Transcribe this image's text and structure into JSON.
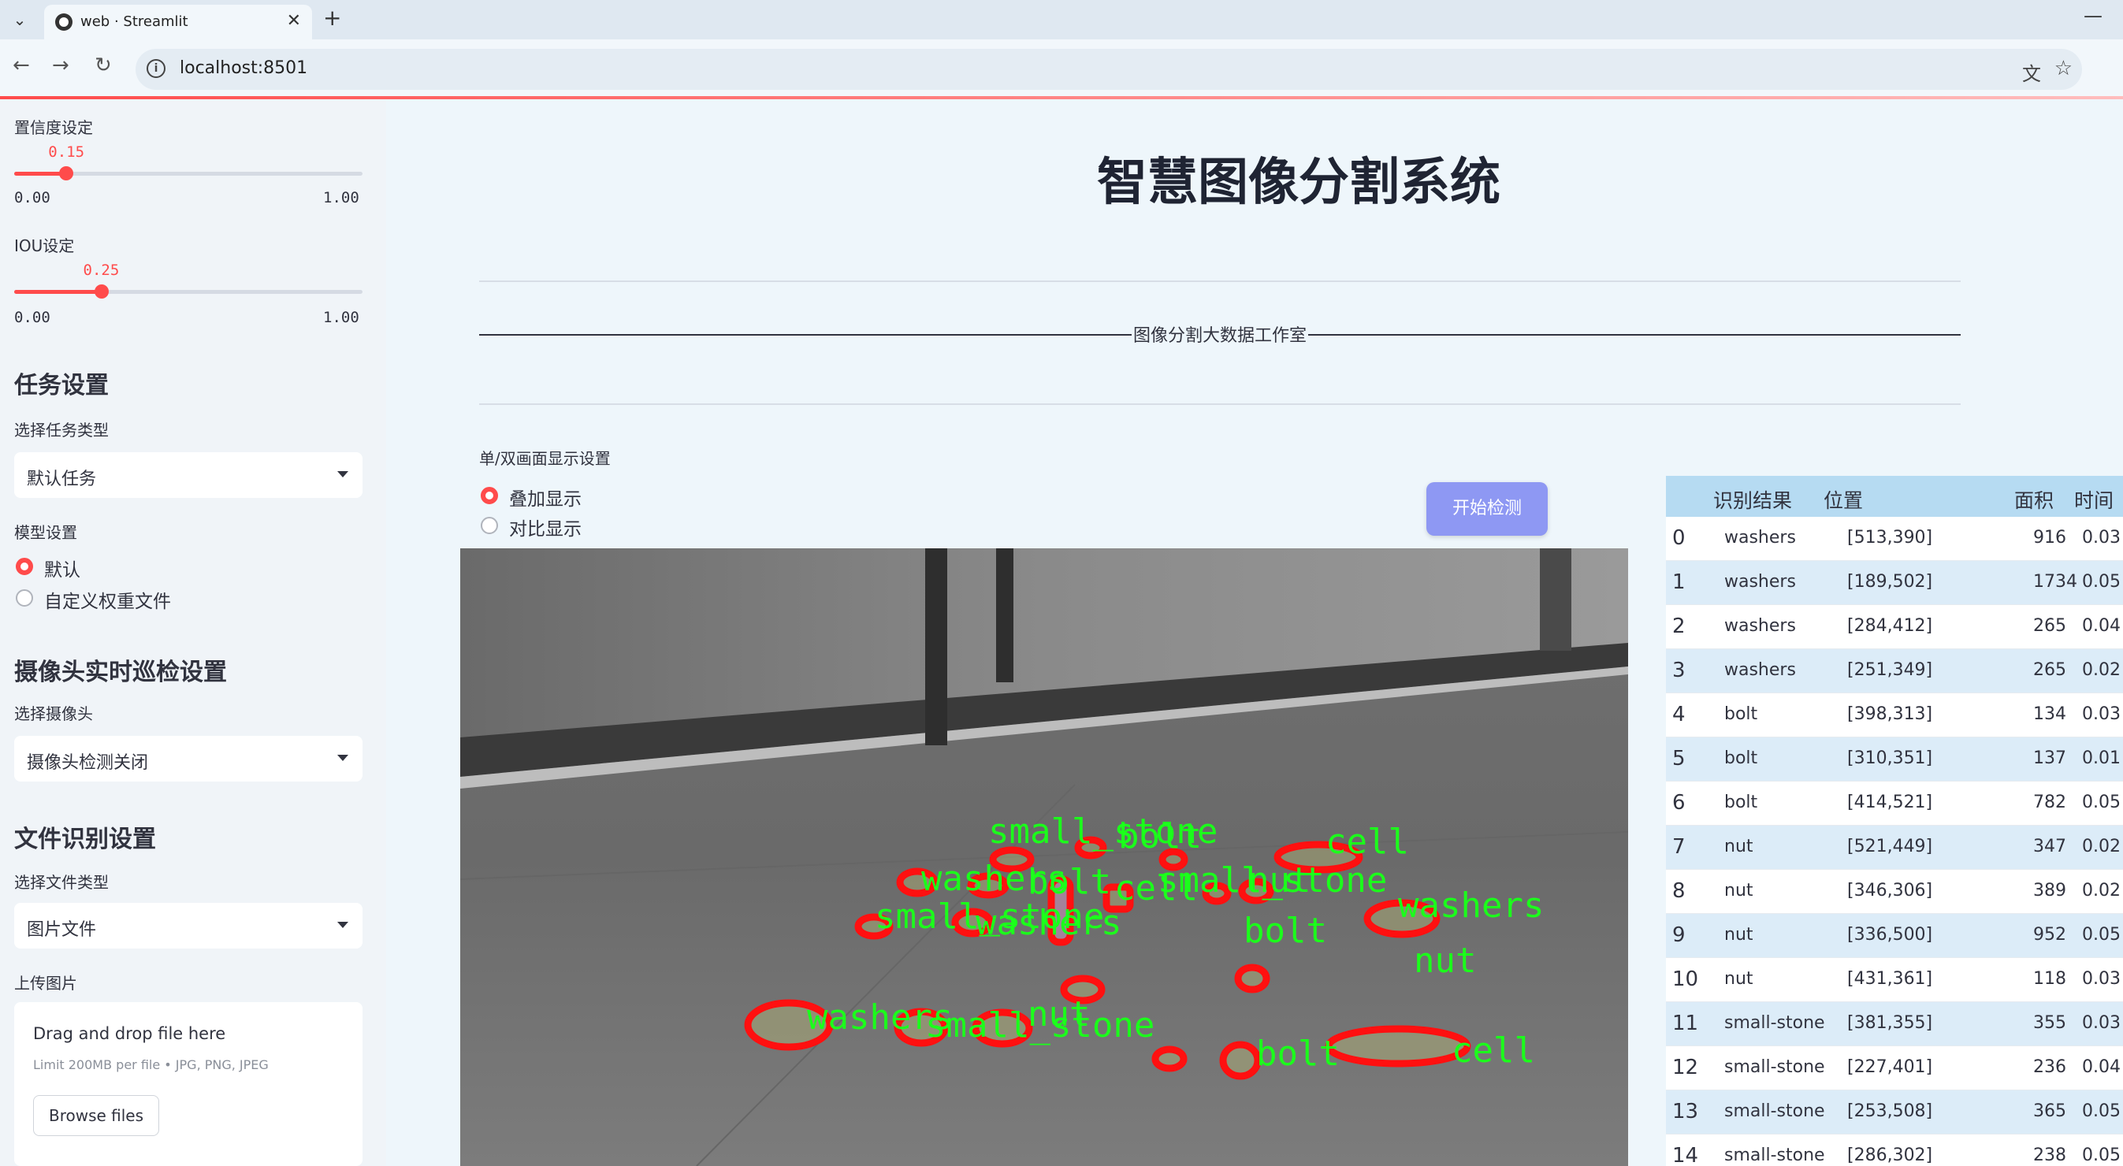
{
  "browser": {
    "tab_title": "web · Streamlit",
    "url": "localhost:8501"
  },
  "sidebar": {
    "confidence_label": "置信度设定",
    "confidence_value": "0.15",
    "confidence_level": 0.15,
    "confidence_min": "0.00",
    "confidence_max": "1.00",
    "iou_label": "IOU设定",
    "iou_value": "0.25",
    "iou_level": 0.25,
    "iou_min": "0.00",
    "iou_max": "1.00",
    "task_header": "任务设置",
    "task_type_label": "选择任务类型",
    "task_type_value": "默认任务",
    "model_label": "模型设置",
    "model_options": [
      "默认",
      "自定义权重文件"
    ],
    "model_selected": 0,
    "camera_header": "摄像头实时巡检设置",
    "camera_label": "选择摄像头",
    "camera_value": "摄像头检测关闭",
    "file_header": "文件识别设置",
    "file_type_label": "选择文件类型",
    "file_type_value": "图片文件",
    "upload_label": "上传图片",
    "upload_title": "Drag and drop file here",
    "upload_limit": "Limit 200MB per file • JPG, PNG, JPEG",
    "upload_button": "Browse files"
  },
  "main": {
    "title": "智慧图像分割系统",
    "studio": "图像分割大数据工作室",
    "display_label": "单/双画面显示设置",
    "display_options": [
      "叠加显示",
      "对比显示"
    ],
    "display_selected": 0,
    "detect_button": "开始检测"
  },
  "detections": [
    {
      "text": "small_stone"
    },
    {
      "text": "bolt"
    },
    {
      "text": "cell"
    },
    {
      "text": "washers"
    },
    {
      "text": "bolt"
    },
    {
      "text": "cell"
    },
    {
      "text": "small_stone"
    },
    {
      "text": "nut"
    },
    {
      "text": "washers"
    },
    {
      "text": "small_stone"
    },
    {
      "text": "washers"
    },
    {
      "text": "bolt"
    },
    {
      "text": "nut"
    },
    {
      "text": "washers"
    },
    {
      "text": "small_stone"
    },
    {
      "text": "nut"
    },
    {
      "text": "bolt"
    },
    {
      "text": "cell"
    }
  ],
  "results_table": {
    "headers": [
      "识别结果",
      "位置",
      "面积",
      "时间"
    ],
    "rows": [
      {
        "idx": "0",
        "name": "washers",
        "pos": "[513,390]",
        "area": "916",
        "time": "0.03"
      },
      {
        "idx": "1",
        "name": "washers",
        "pos": "[189,502]",
        "area": "1734",
        "time": "0.05"
      },
      {
        "idx": "2",
        "name": "washers",
        "pos": "[284,412]",
        "area": "265",
        "time": "0.04"
      },
      {
        "idx": "3",
        "name": "washers",
        "pos": "[251,349]",
        "area": "265",
        "time": "0.02"
      },
      {
        "idx": "4",
        "name": "bolt",
        "pos": "[398,313]",
        "area": "134",
        "time": "0.03"
      },
      {
        "idx": "5",
        "name": "bolt",
        "pos": "[310,351]",
        "area": "137",
        "time": "0.01"
      },
      {
        "idx": "6",
        "name": "bolt",
        "pos": "[414,521]",
        "area": "782",
        "time": "0.05"
      },
      {
        "idx": "7",
        "name": "nut",
        "pos": "[521,449]",
        "area": "347",
        "time": "0.02"
      },
      {
        "idx": "8",
        "name": "nut",
        "pos": "[346,306]",
        "area": "389",
        "time": "0.02"
      },
      {
        "idx": "9",
        "name": "nut",
        "pos": "[336,500]",
        "area": "952",
        "time": "0.05"
      },
      {
        "idx": "10",
        "name": "nut",
        "pos": "[431,361]",
        "area": "118",
        "time": "0.03"
      },
      {
        "idx": "11",
        "name": "small-stone",
        "pos": "[381,355]",
        "area": "355",
        "time": "0.03"
      },
      {
        "idx": "12",
        "name": "small-stone",
        "pos": "[227,401]",
        "area": "236",
        "time": "0.04"
      },
      {
        "idx": "13",
        "name": "small-stone",
        "pos": "[253,508]",
        "area": "365",
        "time": "0.05"
      },
      {
        "idx": "14",
        "name": "small-stone",
        "pos": "[286,302]",
        "area": "238",
        "time": "0.05"
      }
    ]
  }
}
